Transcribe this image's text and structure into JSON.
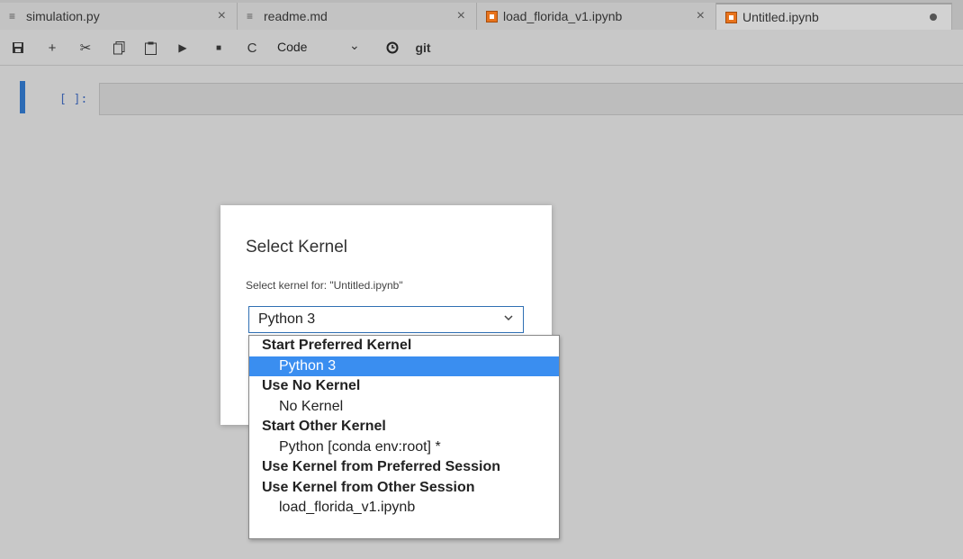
{
  "tabs": [
    {
      "name": "simulation.py",
      "icon": "text-file-icon",
      "close": "×"
    },
    {
      "name": "readme.md",
      "icon": "text-file-icon",
      "close": "×"
    },
    {
      "name": "load_florida_v1.ipynb",
      "icon": "notebook-icon",
      "close": "×"
    },
    {
      "name": "Untitled.ipynb",
      "icon": "notebook-icon",
      "unsaved": true
    }
  ],
  "toolbar": {
    "cell_type": "Code",
    "git_label": "git"
  },
  "cell": {
    "prompt": "[ ]:"
  },
  "dialog": {
    "title": "Select Kernel",
    "subtitle": "Select kernel for: \"Untitled.ipynb\"",
    "selected": "Python 3"
  },
  "dropdown": {
    "options": [
      {
        "label": "Start Preferred Kernel",
        "group": true
      },
      {
        "label": "Python 3",
        "group": false,
        "selected": true
      },
      {
        "label": "Use No Kernel",
        "group": true
      },
      {
        "label": "No Kernel",
        "group": false
      },
      {
        "label": "Start Other Kernel",
        "group": true
      },
      {
        "label": "Python [conda env:root] *",
        "group": false
      },
      {
        "label": "Use Kernel from Preferred Session",
        "group": true
      },
      {
        "label": "Use Kernel from Other Session",
        "group": true
      },
      {
        "label": "load_florida_v1.ipynb",
        "group": false
      }
    ]
  },
  "colors": {
    "accent": "#3a8ef0",
    "cell_marker": "#2c6bb5",
    "notebook_icon": "#e8731c"
  }
}
